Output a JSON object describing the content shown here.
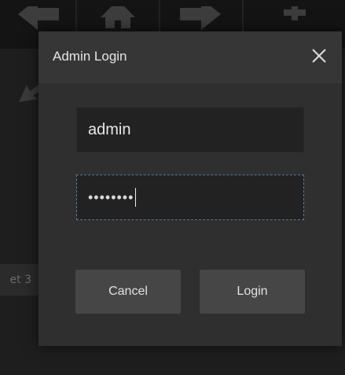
{
  "dialog": {
    "title": "Admin Login",
    "username_value": "admin",
    "password_masked": "••••••••",
    "cancel_label": "Cancel",
    "login_label": "Login"
  },
  "background": {
    "preset_label": "et 3"
  },
  "icons": {
    "close": "close-icon",
    "home": "home-icon",
    "arrow_left": "arrow-left-icon",
    "arrow_right": "arrow-right-icon",
    "plus": "plus-icon"
  },
  "colors": {
    "modal_bg": "#343434",
    "field_bg": "#222222",
    "button_bg": "#464646",
    "focus_border": "#5c7a9a",
    "text": "#e6e6e6"
  }
}
